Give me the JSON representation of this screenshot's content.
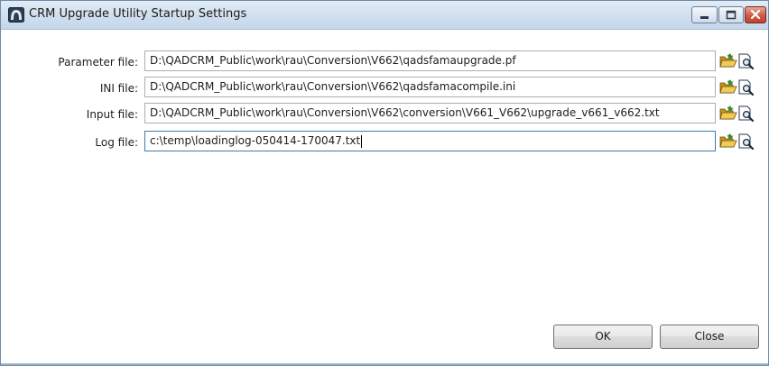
{
  "window": {
    "title": "CRM Upgrade Utility Startup Settings"
  },
  "fields": [
    {
      "label": "Parameter file:",
      "value": "D:\\QADCRM_Public\\work\\rau\\Conversion\\V662\\qadsfamaupgrade.pf"
    },
    {
      "label": "INI file:",
      "value": "D:\\QADCRM_Public\\work\\rau\\Conversion\\V662\\qadsfamacompile.ini"
    },
    {
      "label": "Input file:",
      "value": "D:\\QADCRM_Public\\work\\rau\\Conversion\\V662\\conversion\\V661_V662\\upgrade_v661_v662.txt"
    },
    {
      "label": "Log file:",
      "value": "c:\\temp\\loadinglog-050414-170047.txt"
    }
  ],
  "icons": {
    "app": "app-window-icon",
    "browse": "open-folder-icon",
    "view": "document-magnifier-icon"
  },
  "buttons": {
    "ok": "OK",
    "close": "Close"
  },
  "colors": {
    "titlebar": "#d3e1ef",
    "close_button": "#c3402b",
    "folder": "#e7b83a"
  }
}
